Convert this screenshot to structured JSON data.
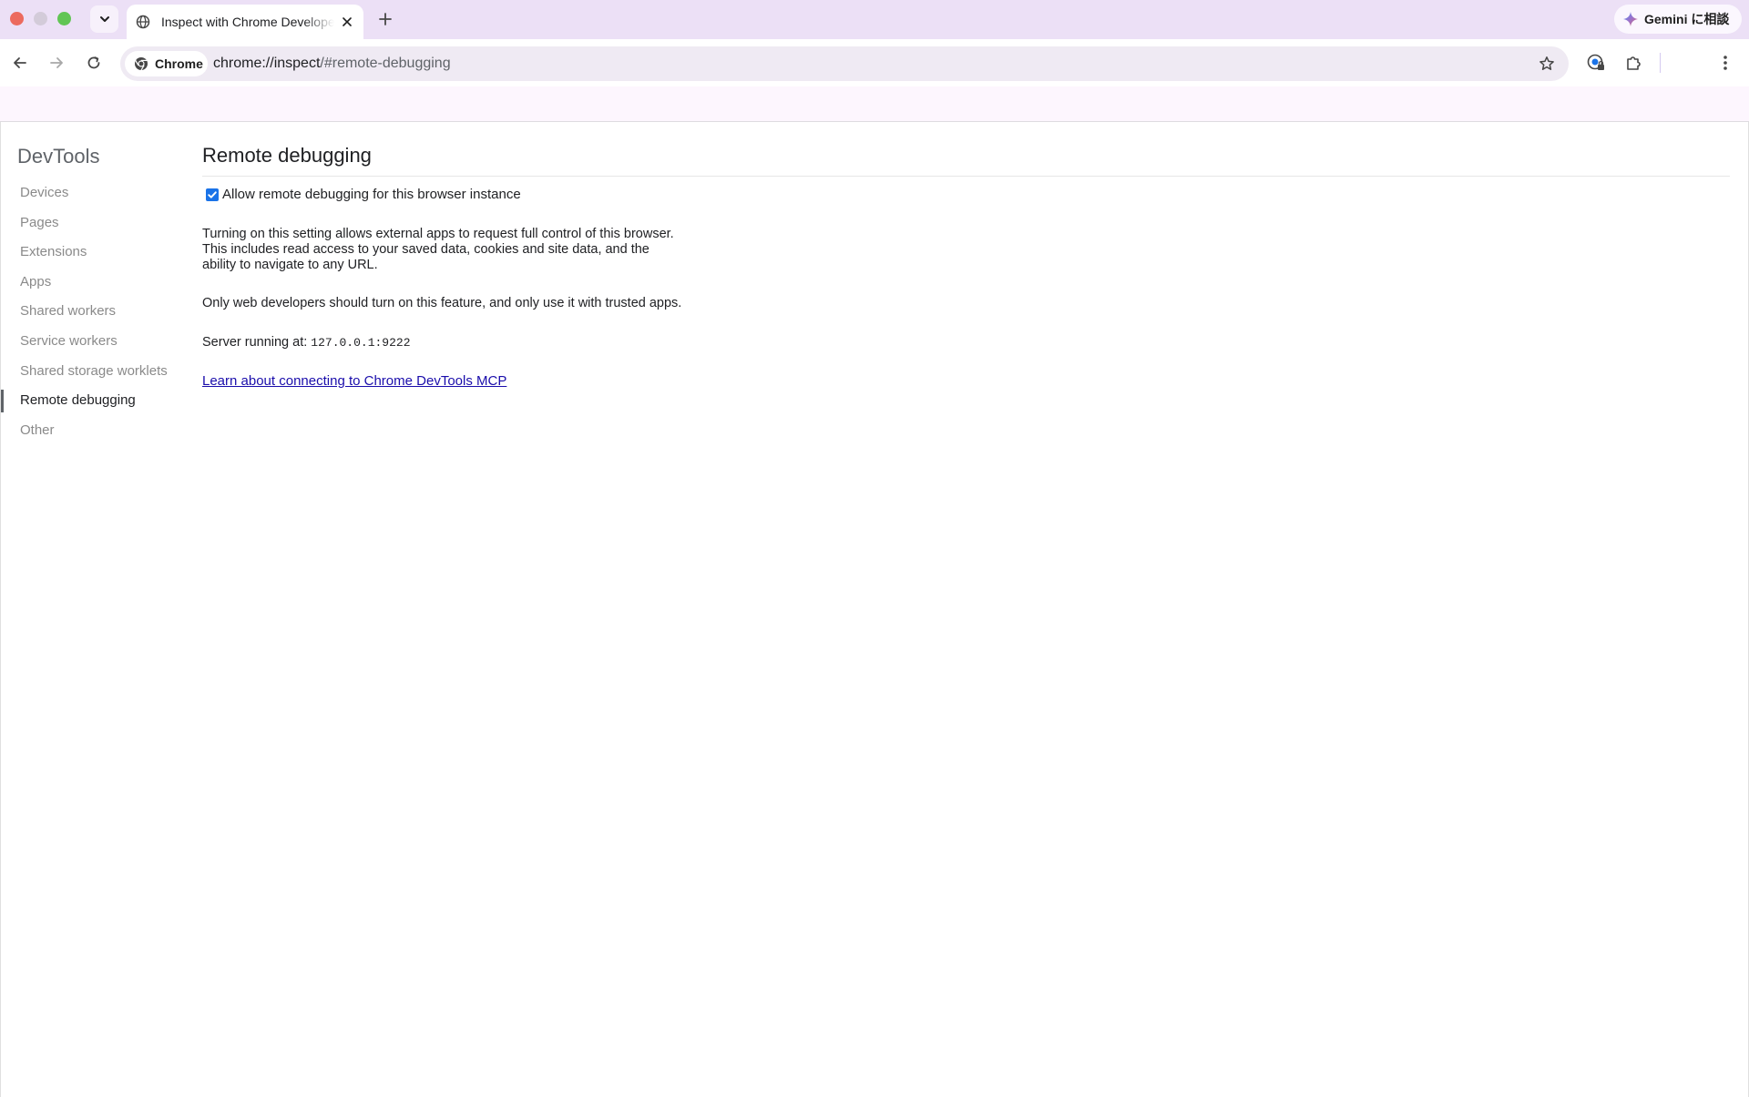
{
  "tab": {
    "title": "Inspect with Chrome Developer Tools",
    "close_icon": "close-icon",
    "favicon": "globe-icon"
  },
  "toolbar": {
    "chip_label": "Chrome",
    "url_host": "chrome://inspect",
    "url_path": "/#remote-debugging"
  },
  "gemini": {
    "label": "Gemini に相談"
  },
  "sidebar": {
    "title": "DevTools",
    "items": [
      {
        "label": "Devices",
        "selected": false
      },
      {
        "label": "Pages",
        "selected": false
      },
      {
        "label": "Extensions",
        "selected": false
      },
      {
        "label": "Apps",
        "selected": false
      },
      {
        "label": "Shared workers",
        "selected": false
      },
      {
        "label": "Service workers",
        "selected": false
      },
      {
        "label": "Shared storage worklets",
        "selected": false
      },
      {
        "label": "Remote debugging",
        "selected": true
      },
      {
        "label": "Other",
        "selected": false
      }
    ]
  },
  "main": {
    "heading": "Remote debugging",
    "checkbox_label": "Allow remote debugging for this browser instance",
    "checkbox_checked": true,
    "description_lines": [
      "Turning on this setting allows external apps to request full control of this browser.",
      "This includes read access to your saved data, cookies and site data, and the",
      "ability to navigate to any URL."
    ],
    "warning": "Only web developers should turn on this feature, and only use it with trusted apps.",
    "server_label": "Server running at: ",
    "server_value": "127.0.0.1:9222",
    "link_text": "Learn about connecting to Chrome DevTools MCP"
  },
  "colors": {
    "tabstrip": "#ece0f6",
    "accent": "#1a73e8",
    "link": "#1a0dab"
  }
}
